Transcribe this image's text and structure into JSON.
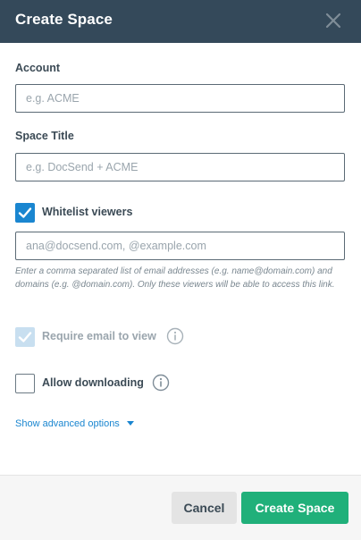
{
  "header": {
    "title": "Create Space",
    "close_icon": "close-icon"
  },
  "account": {
    "label": "Account",
    "value": "",
    "placeholder": "e.g. ACME"
  },
  "space_title": {
    "label": "Space Title",
    "value": "",
    "placeholder": "e.g. DocSend + ACME"
  },
  "whitelist": {
    "label": "Whitelist viewers",
    "checked": true,
    "value": "",
    "placeholder": "ana@docsend.com, @example.com",
    "help_text": "Enter a comma separated list of email addresses (e.g. name@domain.com) and domains (e.g. @domain.com). Only these viewers will be able to access this link."
  },
  "require_email": {
    "label": "Require email to view",
    "checked": true,
    "disabled": true,
    "info_icon": "info-icon"
  },
  "allow_downloading": {
    "label": "Allow downloading",
    "checked": false,
    "info_icon": "info-icon"
  },
  "advanced": {
    "label": "Show advanced options",
    "icon": "caret-down-icon"
  },
  "footer": {
    "cancel_label": "Cancel",
    "submit_label": "Create Space"
  },
  "colors": {
    "header_bg": "#34495a",
    "accent_blue": "#1a86d0",
    "primary_green": "#20b07a",
    "cancel_bg": "#e4e4e4"
  }
}
